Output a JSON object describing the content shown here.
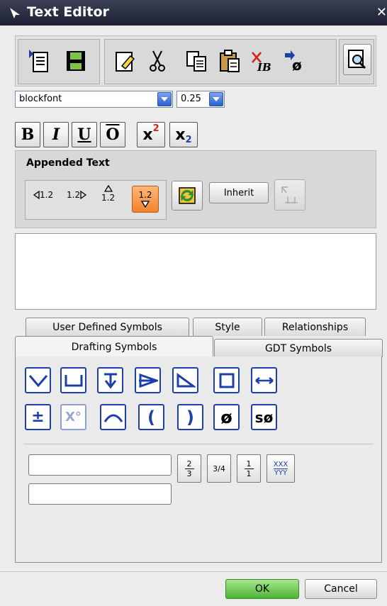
{
  "window": {
    "title": "Text Editor",
    "close_glyph": "✕"
  },
  "toolbar": {
    "icons": [
      "import-text-icon",
      "save-icon",
      "clear-icon",
      "cut-icon",
      "copy-icon",
      "paste-icon",
      "delete-font-icon",
      "insert-symbol-icon",
      "preview-icon"
    ]
  },
  "font": {
    "name": "blockfont",
    "size": "0.25"
  },
  "format_buttons": {
    "bold": "B",
    "italic": "I",
    "underline": "U",
    "overline": "O",
    "superscript_base": "x",
    "superscript_sup": "2",
    "subscript_base": "x",
    "subscript_sub": "2"
  },
  "appended_text": {
    "title": "Appended Text",
    "before_label": "1.2",
    "after_label": "1.2",
    "above_label": "1.2",
    "below_label": "1.2",
    "inherit_label": "Inherit"
  },
  "editor": {
    "text": ""
  },
  "tabs_row1": [
    "User Defined Symbols",
    "Style",
    "Relationships"
  ],
  "tabs_row2": {
    "drafting": "Drafting Symbols",
    "gdt": "GDT Symbols"
  },
  "drafting_symbols": {
    "row1": [
      "countersink-icon",
      "counterbore-icon",
      "depth-icon",
      "conical-taper-icon",
      "slope-icon",
      "square-icon",
      "arc-length-icon"
    ],
    "row2_text": {
      "plusminus": "±",
      "degree": "X°",
      "arc": "⌒",
      "lparen": "(",
      "rparen": ")",
      "diameter": "ø",
      "spherical": "sø"
    }
  },
  "fractions": {
    "f1_num": "2",
    "f1_den": "3",
    "f2": "3/4",
    "f3_num": "1",
    "f3_den": "1",
    "f4_num": "XXX",
    "f4_den": "YYY"
  },
  "inputs": {
    "top_value": "",
    "bottom_value": ""
  },
  "footer": {
    "ok": "OK",
    "cancel": "Cancel"
  },
  "colors": {
    "accent": "#1d3fa8",
    "ok_green": "#5fc04a",
    "title_bar": "#1d2133"
  }
}
